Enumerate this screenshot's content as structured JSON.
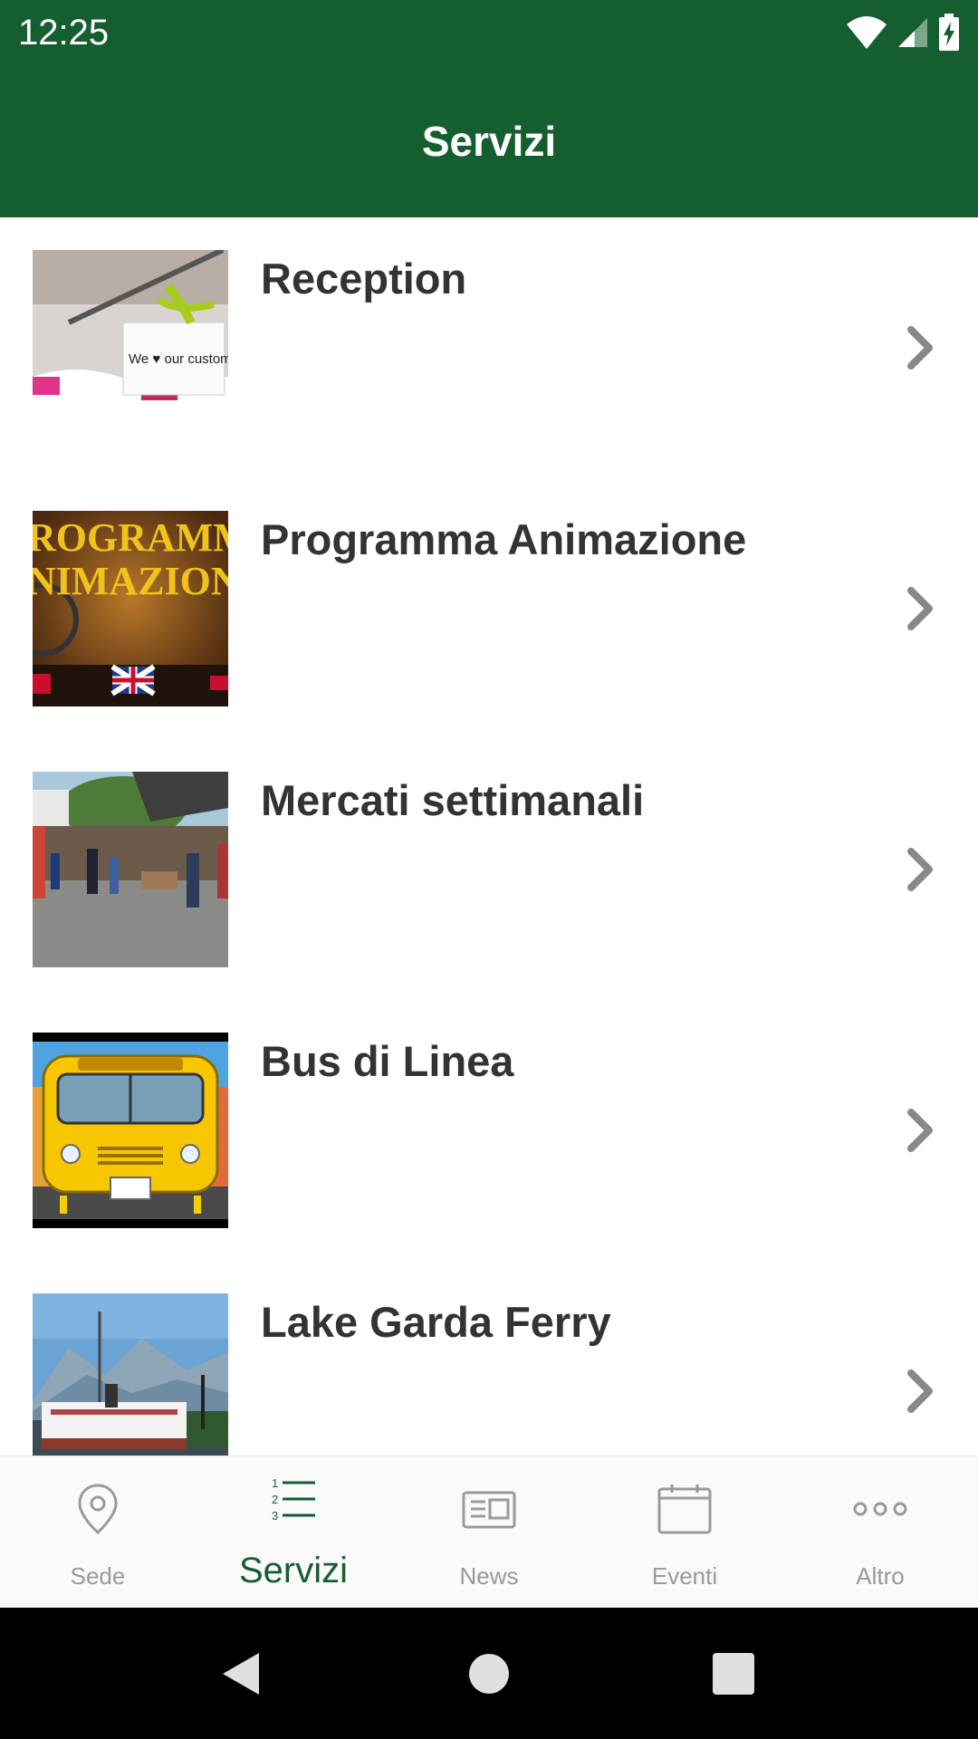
{
  "status_bar": {
    "time": "12:25"
  },
  "app_bar": {
    "title": "Servizi"
  },
  "list": {
    "items": [
      {
        "title": "Reception",
        "thumb_text": "We ♥ our customers"
      },
      {
        "title": "Programma Animazione",
        "thumb_text_1": "ROGRAMM",
        "thumb_text_2": "NIMAZION"
      },
      {
        "title": "Mercati settimanali"
      },
      {
        "title": "Bus di Linea"
      },
      {
        "title": "Lake Garda Ferry"
      }
    ]
  },
  "bottom_nav": {
    "tabs": [
      {
        "label": "Sede",
        "icon": "location-pin-icon"
      },
      {
        "label": "Servizi",
        "icon": "numbered-list-icon",
        "active": true
      },
      {
        "label": "News",
        "icon": "newspaper-icon"
      },
      {
        "label": "Eventi",
        "icon": "calendar-icon"
      },
      {
        "label": "Altro",
        "icon": "more-dots-icon"
      }
    ]
  },
  "colors": {
    "primary": "#155e30",
    "title_text": "#333333",
    "inactive_tab": "#9a9a9a"
  }
}
